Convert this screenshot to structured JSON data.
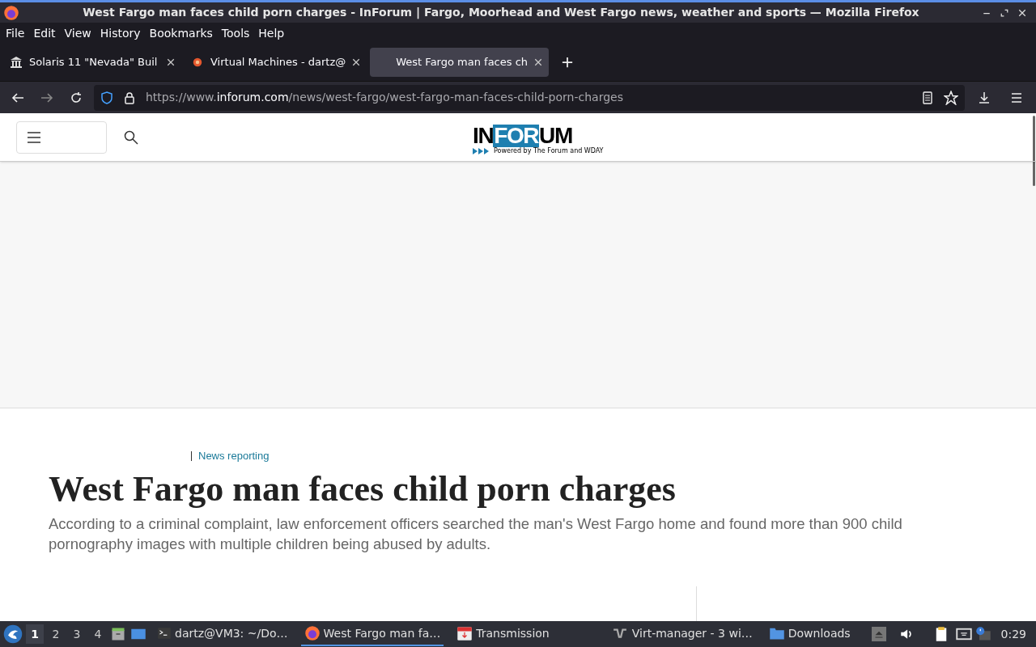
{
  "window": {
    "title": "West Fargo man faces child porn charges - InForum | Fargo, Moorhead and West Fargo news, weather and sports — Mozilla Firefox"
  },
  "menu": [
    "File",
    "Edit",
    "View",
    "History",
    "Bookmarks",
    "Tools",
    "Help"
  ],
  "tabs": [
    {
      "label": "Solaris 11 \"Nevada\" Buil",
      "selected": false,
      "kind": "building"
    },
    {
      "label": "Virtual Machines - dartz@",
      "selected": false,
      "kind": "orange"
    },
    {
      "label": "West Fargo man faces ch",
      "selected": true,
      "kind": "none"
    }
  ],
  "address": {
    "scheme": "https://www.",
    "domain": "inforum.com",
    "path": "/news/west-fargo/west-fargo-man-faces-child-porn-charges"
  },
  "site": {
    "logo": {
      "brand_left": "IN",
      "brand_mid": "FOR",
      "brand_right": "UM",
      "tagline": "Powered by The Forum and WDAY"
    }
  },
  "article": {
    "section": "News reporting",
    "headline": "West Fargo man faces child porn charges",
    "summary": "According to a criminal complaint, law enforcement officers searched the man's West Fargo home and found more than 900 child pornography images with multiple children being abused by adults."
  },
  "taskbar": {
    "workspaces": [
      {
        "label": "1",
        "selected": true
      },
      {
        "label": "2",
        "selected": false
      },
      {
        "label": "3",
        "selected": false
      },
      {
        "label": "4",
        "selected": false
      }
    ],
    "tasks": [
      {
        "label": "dartz@VM3: ~/Do…",
        "selected": false,
        "kind": "terminal"
      },
      {
        "label": "West Fargo man fa…",
        "selected": true,
        "kind": "firefox"
      },
      {
        "label": "Transmission",
        "selected": false,
        "kind": "transmission"
      },
      {
        "label": "Virt-manager - 3 wi…",
        "selected": false,
        "kind": "virt"
      },
      {
        "label": "Downloads",
        "selected": false,
        "kind": "folder"
      }
    ],
    "clock": "0:29"
  }
}
